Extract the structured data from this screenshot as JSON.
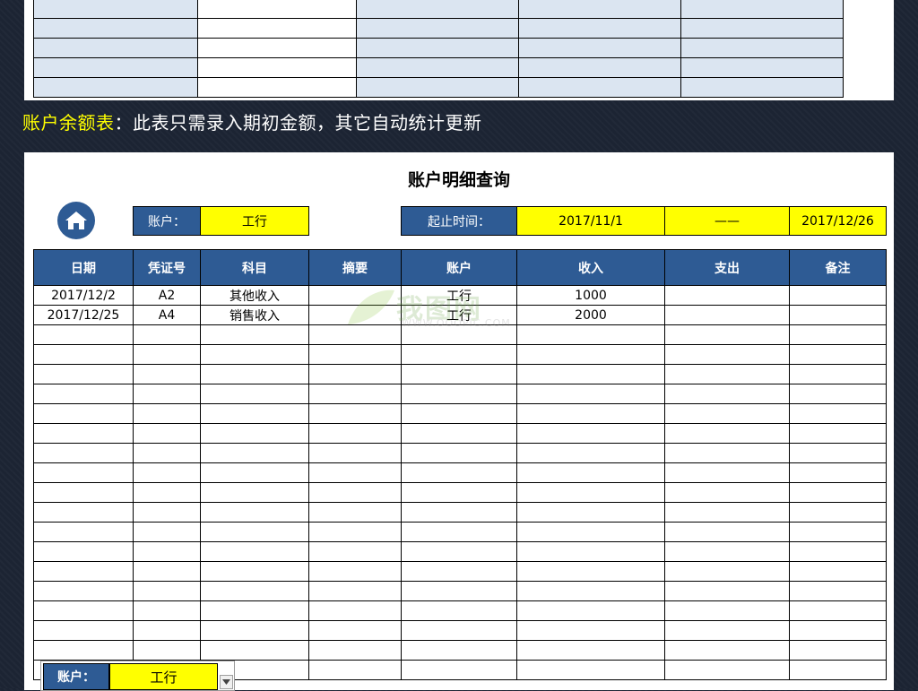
{
  "top_table": {
    "rows": 5,
    "col_colors": [
      "blue",
      "white",
      "blue",
      "blue",
      "blue"
    ]
  },
  "caption": {
    "highlight": "账户余额表",
    "rest": "：此表只需录入期初金额，其它自动统计更新"
  },
  "query": {
    "title": "账户明细查询",
    "account_label": "账户：",
    "account_value": "工行",
    "period_label": "起止时间：",
    "start_date": "2017/11/1",
    "dash": "——",
    "end_date": "2017/12/26"
  },
  "table": {
    "headers": [
      "日期",
      "凭证号",
      "科目",
      "摘要",
      "账户",
      "收入",
      "支出",
      "备注"
    ],
    "rows": [
      [
        "2017/12/2",
        "A2",
        "其他收入",
        "",
        "工行",
        "1000",
        "",
        ""
      ],
      [
        "2017/12/25",
        "A4",
        "销售收入",
        "",
        "工行",
        "2000",
        "",
        ""
      ]
    ],
    "empty_rows": 18
  },
  "watermark": {
    "main": "我图网",
    "sub": "WWW.OOOPIC.COM"
  },
  "dropdown": {
    "label": "账户：",
    "value": "工行"
  },
  "colors": {
    "header_blue": "#2e5b94",
    "highlight_yellow": "#ffff00",
    "light_blue": "#dbe5f1",
    "background": "#1c2433"
  }
}
